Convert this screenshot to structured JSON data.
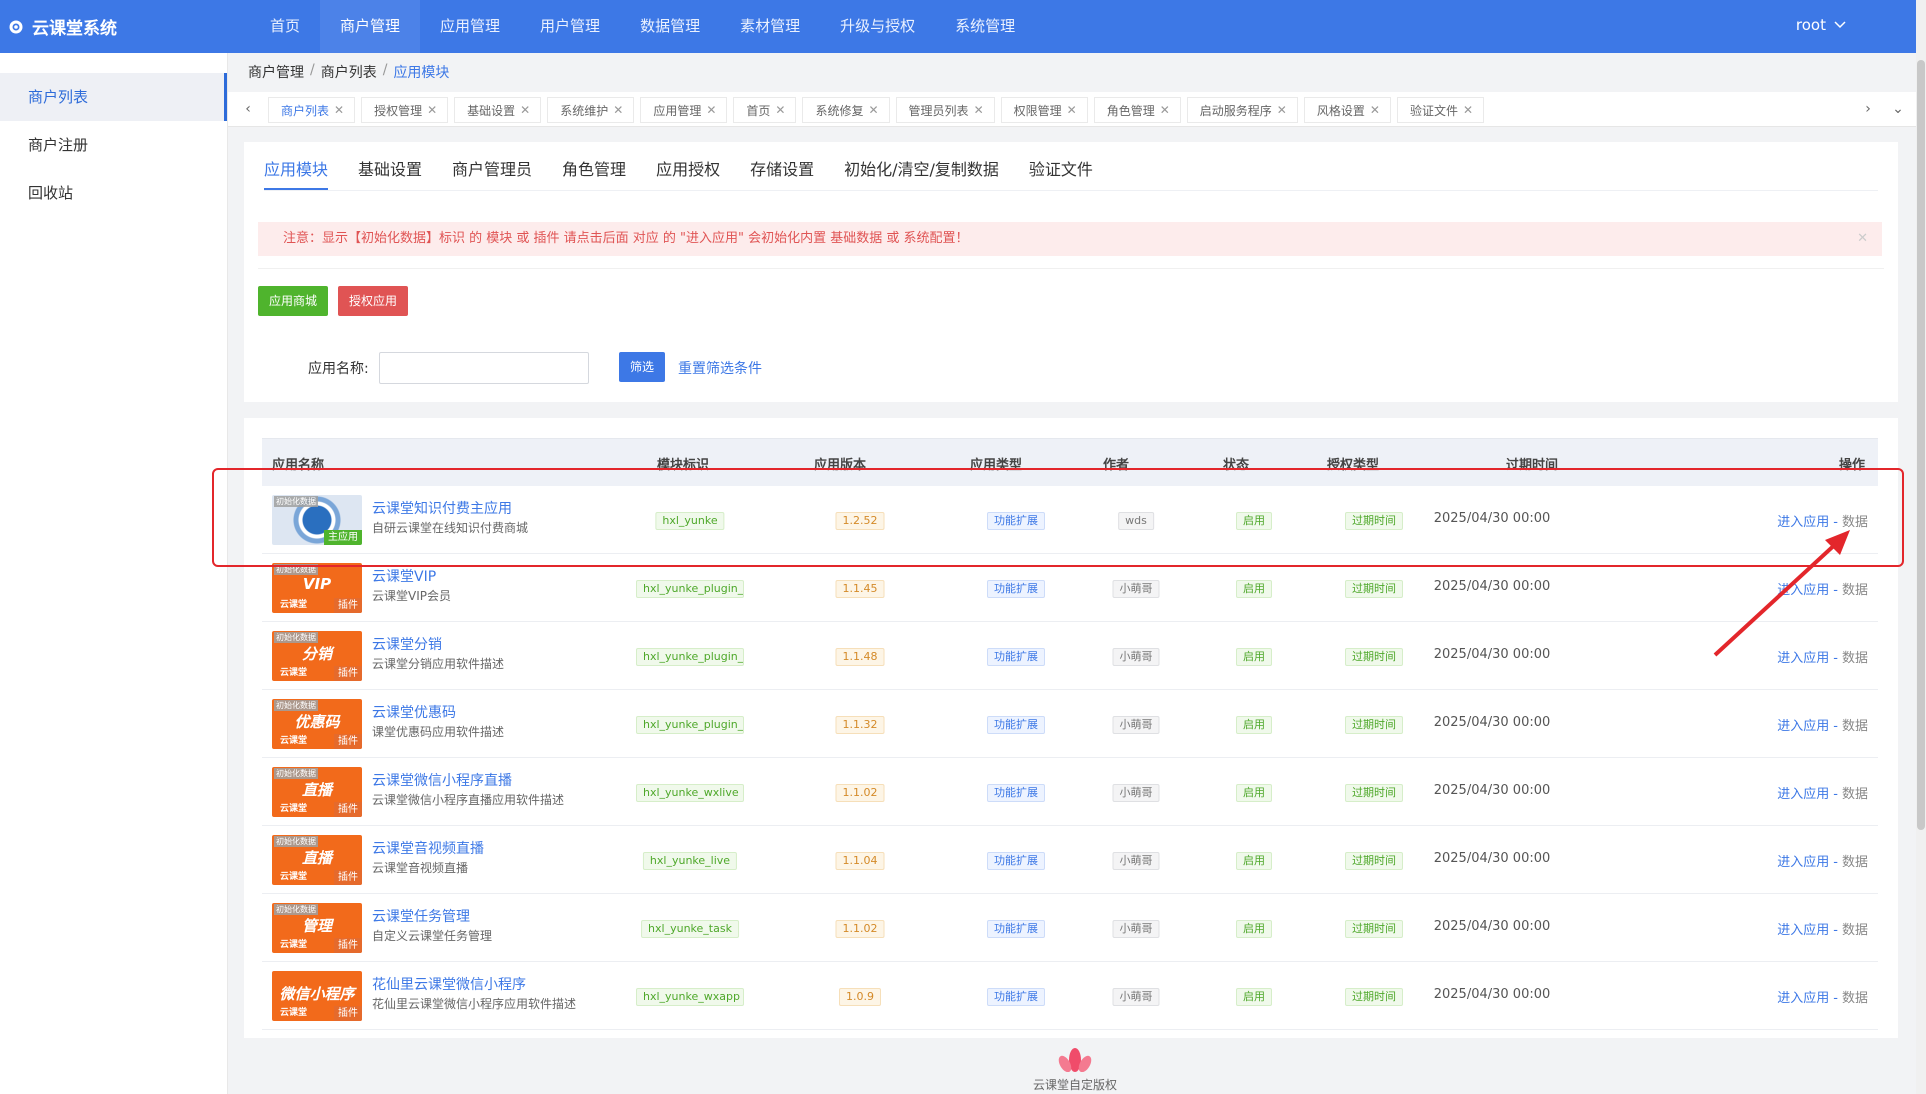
{
  "app": {
    "title": "云课堂系统",
    "user": "root"
  },
  "topnav": [
    "首页",
    "商户管理",
    "应用管理",
    "用户管理",
    "数据管理",
    "素材管理",
    "升级与授权",
    "系统管理"
  ],
  "sidebar": [
    "商户列表",
    "商户注册",
    "回收站"
  ],
  "breadcrumb": [
    "商户管理",
    "商户列表",
    "应用模块"
  ],
  "tabs": [
    "商户列表",
    "授权管理",
    "基础设置",
    "系统维护",
    "应用管理",
    "首页",
    "系统修复",
    "管理员列表",
    "权限管理",
    "角色管理",
    "启动服务程序",
    "风格设置",
    "验证文件"
  ],
  "subtabs": [
    "应用模块",
    "基础设置",
    "商户管理员",
    "角色管理",
    "应用授权",
    "存储设置",
    "初始化/清空/复制数据",
    "验证文件"
  ],
  "alert": "注意：显示【初始化数据】标识 的 模块 或 插件 请点击后面 对应 的 \"进入应用\" 会初始化内置 基础数据 或 系统配置！",
  "buttons": {
    "store": "应用商城",
    "authorize": "授权应用",
    "filter": "筛选",
    "reset": "重置筛选条件"
  },
  "filter": {
    "label": "应用名称:",
    "value": ""
  },
  "columns": [
    "应用名称",
    "模块标识",
    "应用版本",
    "应用类型",
    "作者",
    "状态",
    "授权类型",
    "过期时间",
    "操作"
  ],
  "rows": [
    {
      "name": "云课堂知识付费主应用",
      "desc": "自研云课堂在线知识付费商城",
      "module": "hxl_yunke",
      "version": "1.2.52",
      "type": "功能扩展",
      "author": "wds",
      "status": "启用",
      "auth": "过期时间",
      "expire": "2025/04/30 00:00",
      "thumb_tl": "初始化数据",
      "thumb_br": "主应用",
      "thumb_big": "",
      "thumb_sm": ""
    },
    {
      "name": "云课堂VIP",
      "desc": "云课堂VIP会员",
      "module": "hxl_yunke_plugin_v",
      "version": "1.1.45",
      "type": "功能扩展",
      "author": "小萌哥",
      "status": "启用",
      "auth": "过期时间",
      "expire": "2025/04/30 00:00",
      "thumb_tl": "初始化数据",
      "thumb_br": "插件",
      "thumb_big": "VIP",
      "thumb_sm": "云课堂"
    },
    {
      "name": "云课堂分销",
      "desc": "云课堂分销应用软件描述",
      "module": "hxl_yunke_plugin_c",
      "version": "1.1.48",
      "type": "功能扩展",
      "author": "小萌哥",
      "status": "启用",
      "auth": "过期时间",
      "expire": "2025/04/30 00:00",
      "thumb_tl": "初始化数据",
      "thumb_br": "插件",
      "thumb_big": "分销",
      "thumb_sm": "云课堂"
    },
    {
      "name": "云课堂优惠码",
      "desc": "课堂优惠码应用软件描述",
      "module": "hxl_yunke_plugin_c",
      "version": "1.1.32",
      "type": "功能扩展",
      "author": "小萌哥",
      "status": "启用",
      "auth": "过期时间",
      "expire": "2025/04/30 00:00",
      "thumb_tl": "初始化数据",
      "thumb_br": "插件",
      "thumb_big": "优惠码",
      "thumb_sm": "云课堂"
    },
    {
      "name": "云课堂微信小程序直播",
      "desc": "云课堂微信小程序直播应用软件描述",
      "module": "hxl_yunke_wxlive",
      "version": "1.1.02",
      "type": "功能扩展",
      "author": "小萌哥",
      "status": "启用",
      "auth": "过期时间",
      "expire": "2025/04/30 00:00",
      "thumb_tl": "初始化数据",
      "thumb_br": "插件",
      "thumb_big": "直播",
      "thumb_sm": "云课堂"
    },
    {
      "name": "云课堂音视频直播",
      "desc": "云课堂音视频直播",
      "module": "hxl_yunke_live",
      "version": "1.1.04",
      "type": "功能扩展",
      "author": "小萌哥",
      "status": "启用",
      "auth": "过期时间",
      "expire": "2025/04/30 00:00",
      "thumb_tl": "初始化数据",
      "thumb_br": "插件",
      "thumb_big": "直播",
      "thumb_sm": "云课堂"
    },
    {
      "name": "云课堂任务管理",
      "desc": "自定义云课堂任务管理",
      "module": "hxl_yunke_task",
      "version": "1.1.02",
      "type": "功能扩展",
      "author": "小萌哥",
      "status": "启用",
      "auth": "过期时间",
      "expire": "2025/04/30 00:00",
      "thumb_tl": "初始化数据",
      "thumb_br": "插件",
      "thumb_big": "管理",
      "thumb_sm": "云课堂"
    },
    {
      "name": "花仙里云课堂微信小程序",
      "desc": "花仙里云课堂微信小程序应用软件描述",
      "module": "hxl_yunke_wxapp",
      "version": "1.0.9",
      "type": "功能扩展",
      "author": "小萌哥",
      "status": "启用",
      "auth": "过期时间",
      "expire": "2025/04/30 00:00",
      "thumb_tl": "",
      "thumb_br": "插件",
      "thumb_big": "微信小程序",
      "thumb_sm": "云课堂"
    }
  ],
  "ops": {
    "enter": "进入应用",
    "dash": "-",
    "data": "数据"
  },
  "footer": {
    "copyright": "云课堂自定版权"
  },
  "colors": {
    "primary": "#3d78e6",
    "alert_bg": "#fdecec",
    "highlight": "#e3262b",
    "green": "#4fb42d",
    "red": "#e05454",
    "thumb_orange": "#f26a1b"
  }
}
